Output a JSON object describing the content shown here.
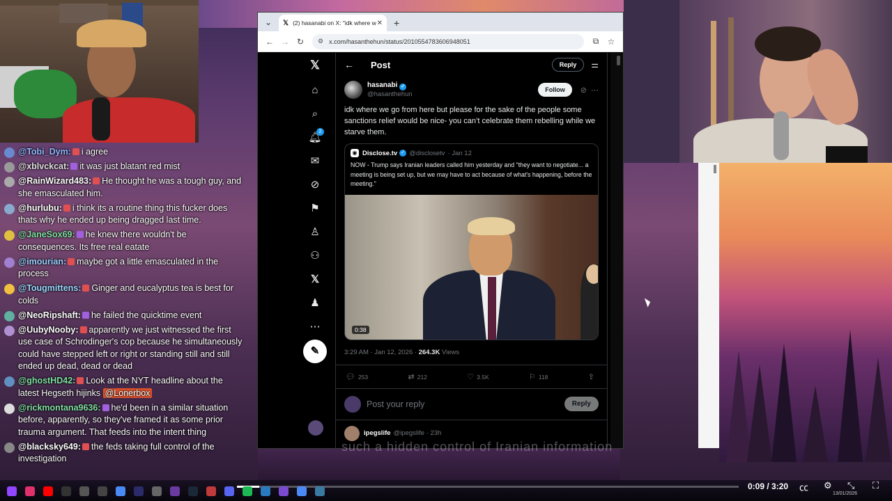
{
  "browser": {
    "tab_title": "(2) hasanabi on X: \"idk where w",
    "url": "x.com/hasanthehun/status/2010554783606948051"
  },
  "x": {
    "header_title": "Post",
    "reply_top_label": "Reply",
    "author_name": "hasanabi",
    "author_handle": "@hasanthehun",
    "follow_label": "Follow",
    "tweet_text": "idk where we go from here but please for the sake of the people some sanctions relief would be nice- you can’t celebrate them rebelling while we starve them.",
    "quote": {
      "name": "Disclose.tv",
      "handle": "@disclosetv",
      "date": "· Jan 12",
      "text": "NOW - Trump says Iranian leaders called him yesterday and \"they want to negotiate... a meeting is being set up, but we may have to act because of what's happening, before the meeting.\"",
      "video_duration": "0:38"
    },
    "meta_time": "3:29 AM · Jan 12, 2026 ·",
    "meta_views": "264.3K",
    "meta_views_label": "Views",
    "actions": {
      "replies": "253",
      "reposts": "212",
      "likes": "3.5K",
      "bookmarks": "118"
    },
    "compose_placeholder": "Post your reply",
    "reply_button": "Reply",
    "next_reply_name": "ipegslife",
    "next_reply_handle": "@ipegslife · 23h",
    "notification_count": "2"
  },
  "chat": [
    {
      "name": "@Tobi_Dym:",
      "msg": "i agree",
      "color": "#8fb8ff"
    },
    {
      "name": "@xblvckcat:",
      "msg": "it was just blatant red mist",
      "color": "#e0e0e0"
    },
    {
      "name": "@RainWizard483:",
      "msg": "He thought he was a tough guy, and she emasculated him.",
      "color": "#ffffff"
    },
    {
      "name": "@hurlubu:",
      "msg": "i think its a routine thing this fucker does thats why he ended up being dragged last time.",
      "color": "#ffffff"
    },
    {
      "name": "@JaneSox69:",
      "msg": "he knew there wouldn't be consequences. Its free real eatate",
      "color": "#7fe0a0"
    },
    {
      "name": "@imourian:",
      "msg": "maybe got a little emasculated in the process",
      "color": "#9ad0ff"
    },
    {
      "name": "@Tougmittens:",
      "msg": "Ginger and eucalyptus tea is best for colds",
      "color": "#9ad8ff"
    },
    {
      "name": "@NeoRipshaft:",
      "msg": "he failed the quicktime event",
      "color": "#ffffff"
    },
    {
      "name": "@UubyNooby:",
      "msg": "apparently we just witnessed the first use case of Schrodinger's cop because he simultaneously could have stepped left or right or standing still and still ended up dead, dead or dead",
      "color": "#ffffff"
    },
    {
      "name": "@ghostHD42:",
      "msg": "Look at the NYT headline about the latest Hegseth hijinks",
      "mention": "@Lonerbox",
      "color": "#7fe0a0"
    },
    {
      "name": "@rickmontana9636:",
      "msg": "he'd been in a similar situation before, apparently, so they've framed it as some prior trauma argument. That feeds into the intent thing",
      "color": "#7fe0a0"
    },
    {
      "name": "@blacksky649:",
      "msg": "the feds taking full control of the investigation",
      "color": "#ffffff"
    }
  ],
  "player": {
    "time": "0:09 / 3:20",
    "progress": 0.045,
    "date": "13/01/2026"
  },
  "subtitle": "such a hidden control of Iranian information"
}
